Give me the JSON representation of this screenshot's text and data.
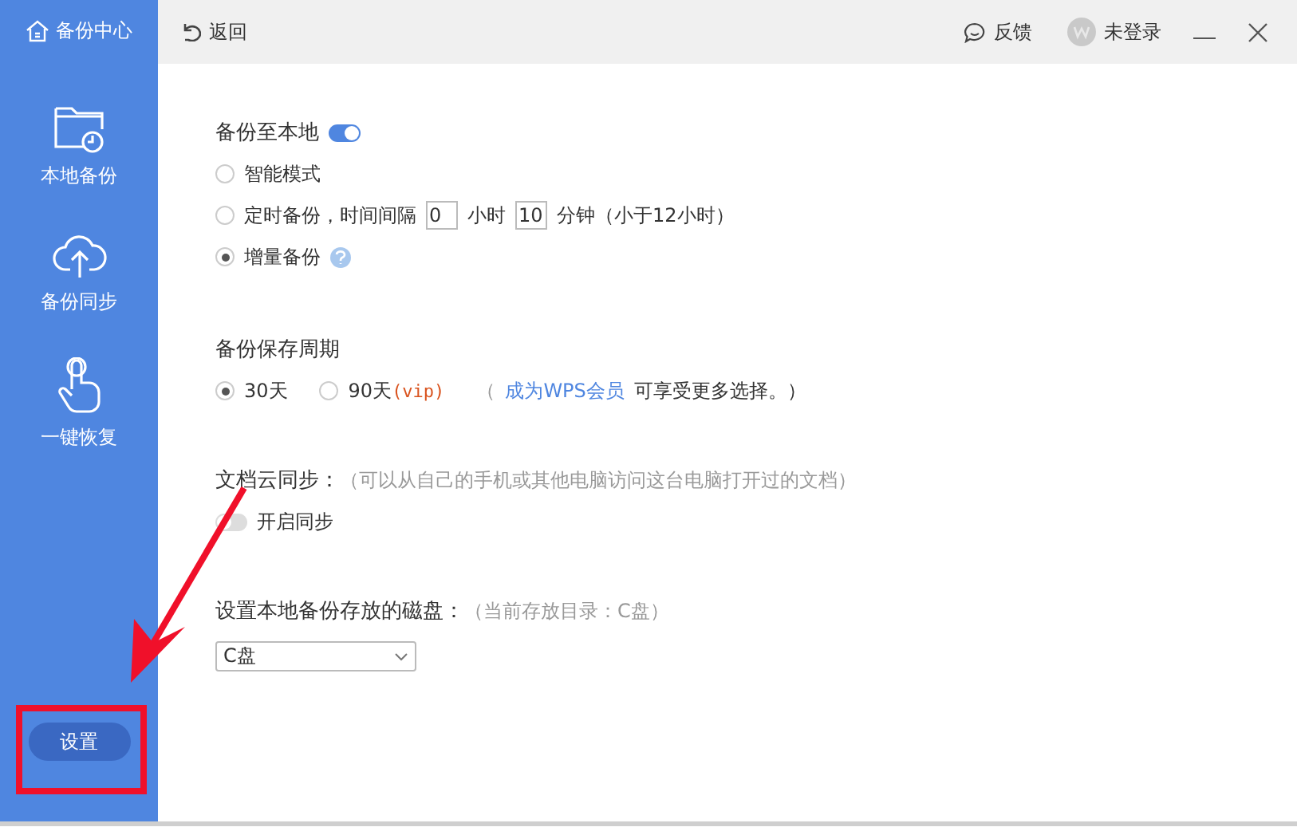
{
  "sidebar": {
    "title": "备份中心",
    "items": [
      {
        "label": "本地备份"
      },
      {
        "label": "备份同步"
      },
      {
        "label": "一键恢复"
      }
    ],
    "settings_button": "设置"
  },
  "topbar": {
    "back": "返回",
    "feedback": "反馈",
    "user": "未登录"
  },
  "local_backup": {
    "label": "备份至本地",
    "on": true,
    "modes": [
      {
        "kind": "plain",
        "label": "智能模式",
        "selected": false
      },
      {
        "kind": "timed",
        "label": "定时备份，时间间隔",
        "hours": "0",
        "hours_unit": "小时",
        "minutes": "10",
        "minutes_unit": "分钟（小于12小时）",
        "selected": false
      },
      {
        "kind": "help",
        "label": "增量备份",
        "selected": true
      }
    ]
  },
  "retention": {
    "label": "备份保存周期",
    "options": [
      {
        "label": "30天",
        "selected": true
      },
      {
        "label": "90天",
        "tag": "(vip)",
        "selected": false
      }
    ],
    "note_prefix": "（",
    "note_link": "成为WPS会员",
    "note_suffix": "可享受更多选择。）"
  },
  "cloud_sync": {
    "title": "文档云同步：",
    "hint": "（可以从自己的手机或其他电脑访问这台电脑打开过的文档）",
    "toggle_label": "开启同步",
    "on": false
  },
  "disk": {
    "title": "设置本地备份存放的磁盘：",
    "hint": "（当前存放目录：C盘）",
    "value": "C盘"
  }
}
